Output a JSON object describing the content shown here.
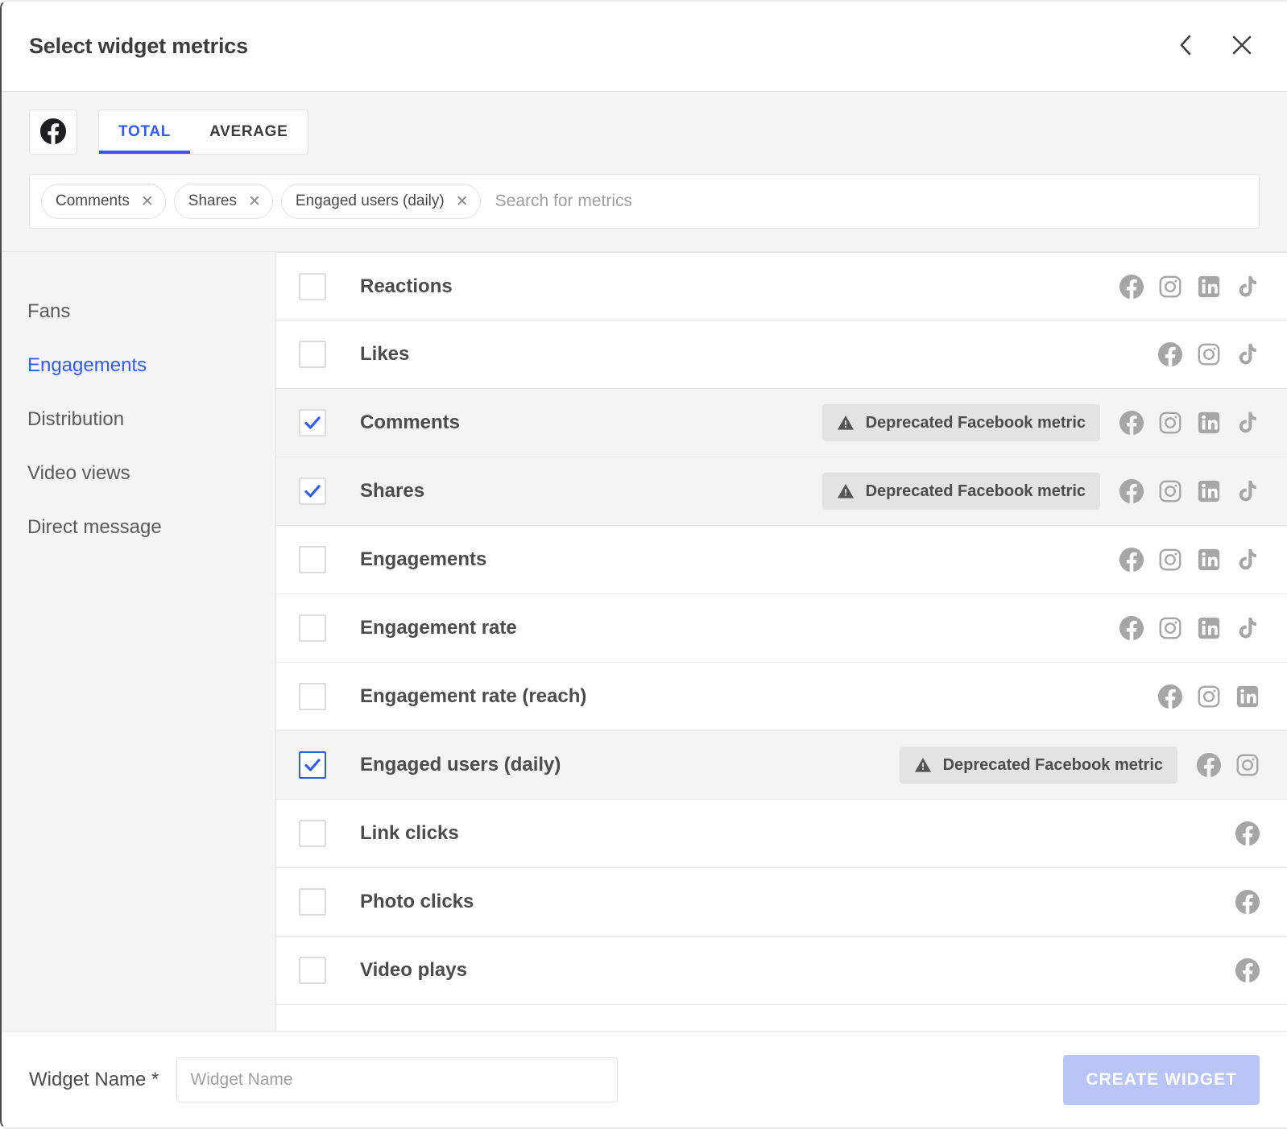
{
  "dialog": {
    "title": "Select widget metrics",
    "back_icon": "chevron-left-icon",
    "close_icon": "close-icon"
  },
  "toolbar": {
    "network_button_icon": "facebook-icon",
    "tabs": [
      {
        "label": "TOTAL",
        "active": true
      },
      {
        "label": "AVERAGE",
        "active": false
      }
    ],
    "search": {
      "placeholder": "Search for metrics",
      "value": "",
      "chips": [
        {
          "label": "Comments",
          "remove_icon": "close-icon"
        },
        {
          "label": "Shares",
          "remove_icon": "close-icon"
        },
        {
          "label": "Engaged users (daily)",
          "remove_icon": "close-icon"
        }
      ]
    }
  },
  "sidebar": {
    "items": [
      {
        "label": "Fans",
        "active": false
      },
      {
        "label": "Engagements",
        "active": true
      },
      {
        "label": "Distribution",
        "active": false
      },
      {
        "label": "Video views",
        "active": false
      },
      {
        "label": "Direct message",
        "active": false
      }
    ]
  },
  "metrics": {
    "deprecated_badge_label": "Deprecated Facebook metric",
    "warning_icon": "warning-triangle-icon",
    "rows": [
      {
        "label": "Reactions",
        "checked": false,
        "focused": false,
        "badge": false,
        "networks": [
          "facebook",
          "instagram",
          "linkedin",
          "tiktok"
        ]
      },
      {
        "label": "Likes",
        "checked": false,
        "focused": false,
        "badge": false,
        "networks": [
          "facebook",
          "instagram",
          "tiktok"
        ]
      },
      {
        "label": "Comments",
        "checked": true,
        "focused": false,
        "badge": true,
        "networks": [
          "facebook",
          "instagram",
          "linkedin",
          "tiktok"
        ]
      },
      {
        "label": "Shares",
        "checked": true,
        "focused": false,
        "badge": true,
        "networks": [
          "facebook",
          "instagram",
          "linkedin",
          "tiktok"
        ]
      },
      {
        "label": "Engagements",
        "checked": false,
        "focused": false,
        "badge": false,
        "networks": [
          "facebook",
          "instagram",
          "linkedin",
          "tiktok"
        ]
      },
      {
        "label": "Engagement rate",
        "checked": false,
        "focused": false,
        "badge": false,
        "networks": [
          "facebook",
          "instagram",
          "linkedin",
          "tiktok"
        ]
      },
      {
        "label": "Engagement rate (reach)",
        "checked": false,
        "focused": false,
        "badge": false,
        "networks": [
          "facebook",
          "instagram",
          "linkedin"
        ]
      },
      {
        "label": "Engaged users (daily)",
        "checked": true,
        "focused": true,
        "badge": true,
        "networks": [
          "facebook",
          "instagram"
        ]
      },
      {
        "label": "Link clicks",
        "checked": false,
        "focused": false,
        "badge": false,
        "networks": [
          "facebook"
        ]
      },
      {
        "label": "Photo clicks",
        "checked": false,
        "focused": false,
        "badge": false,
        "networks": [
          "facebook"
        ]
      },
      {
        "label": "Video plays",
        "checked": false,
        "focused": false,
        "badge": false,
        "networks": [
          "facebook"
        ]
      }
    ]
  },
  "footer": {
    "widget_name_label": "Widget Name *",
    "widget_name_placeholder": "Widget Name",
    "widget_name_value": "",
    "create_label": "CREATE WIDGET"
  },
  "colors": {
    "accent": "#2f5cf5",
    "accent_disabled": "#b9c4f7",
    "row_selected": "#f4f4f4",
    "panel_bg": "#f5f5f5",
    "badge_bg": "#e3e3e3",
    "icon_gray": "#a6a6a6",
    "text": "#4c4c4c"
  }
}
